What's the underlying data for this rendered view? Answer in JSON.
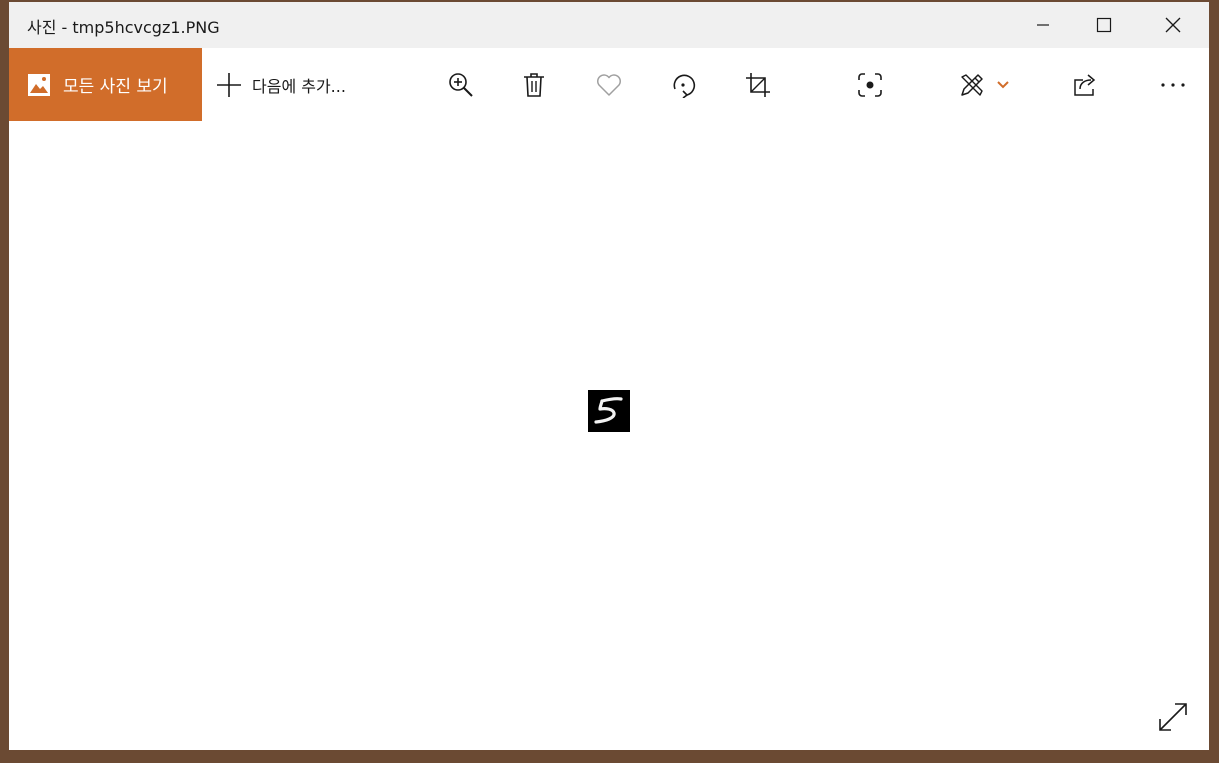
{
  "window": {
    "title": "사진 - tmp5hcvcgz1.PNG"
  },
  "titlebar_buttons": {
    "minimize": "minimize-icon",
    "maximize": "maximize-icon",
    "close": "close-icon"
  },
  "toolbar": {
    "all_photos_label": "모든 사진 보기",
    "add_to_label": "다음에 추가...",
    "icons": [
      "zoom-in-icon",
      "delete-icon",
      "favorite-icon",
      "rotate-icon",
      "crop-icon",
      "visual-search-icon",
      "edit-icon",
      "chevron-down-icon",
      "share-icon",
      "more-icon"
    ]
  },
  "colors": {
    "accent": "#d16d2a",
    "favorite_disabled": "#a0a0a0"
  },
  "content": {
    "image_name": "tmp5hcvcgz1.PNG",
    "expand_icon": "fullscreen-icon"
  }
}
